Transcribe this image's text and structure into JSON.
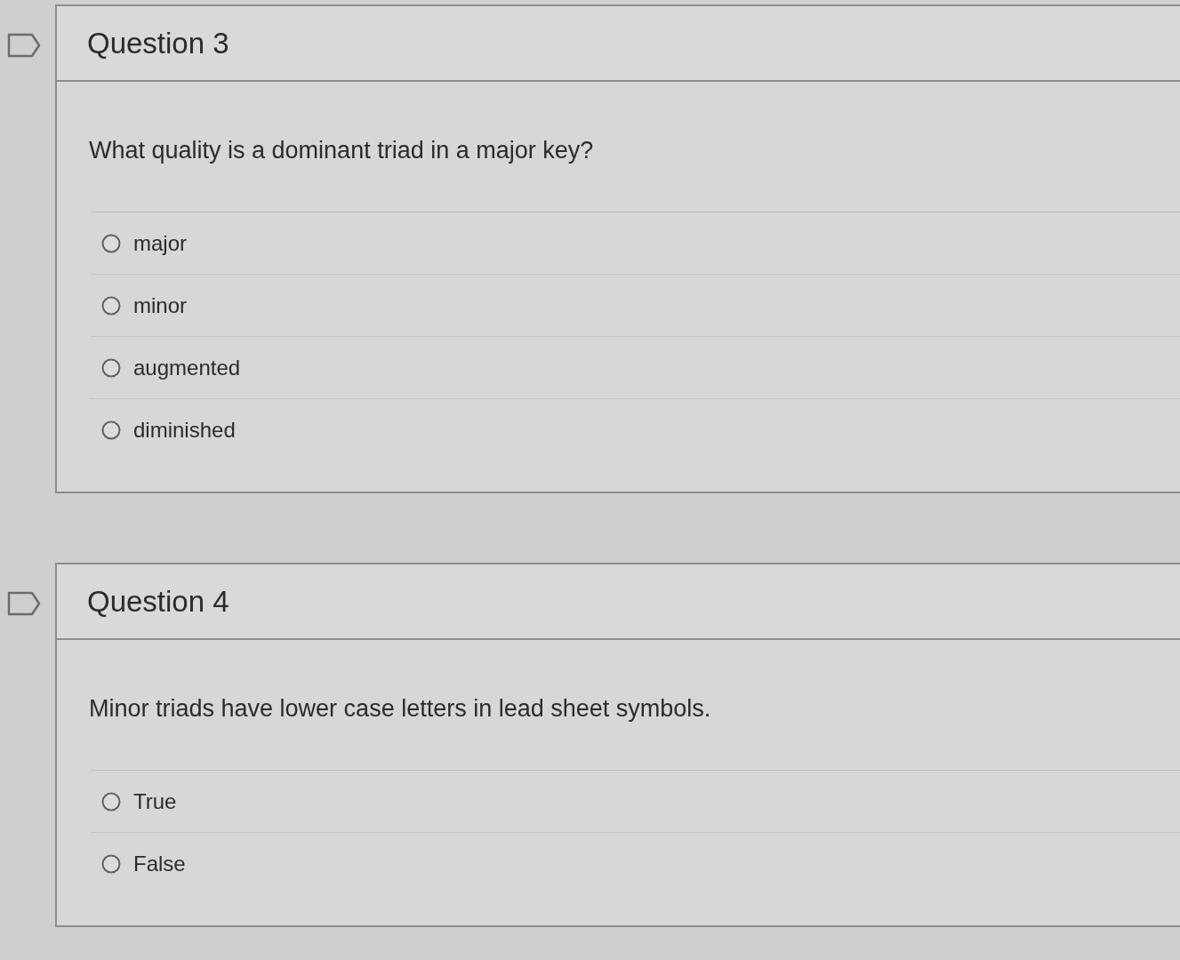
{
  "questions": [
    {
      "flagged": false,
      "title": "Question 3",
      "prompt": "What quality is a dominant triad in a major key?",
      "options": [
        {
          "label": "major",
          "selected": false
        },
        {
          "label": "minor",
          "selected": false
        },
        {
          "label": "augmented",
          "selected": false
        },
        {
          "label": "diminished",
          "selected": false
        }
      ]
    },
    {
      "flagged": false,
      "title": "Question 4",
      "prompt": "Minor triads have lower case letters in lead sheet symbols.",
      "options": [
        {
          "label": "True",
          "selected": false
        },
        {
          "label": "False",
          "selected": false
        }
      ]
    }
  ]
}
